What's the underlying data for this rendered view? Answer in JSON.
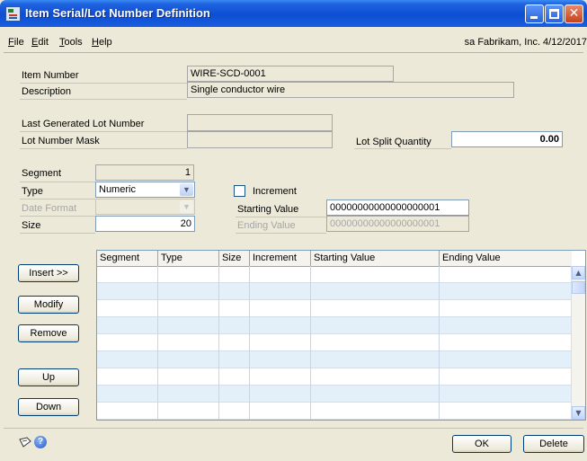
{
  "window": {
    "title": "Item Serial/Lot Number Definition"
  },
  "menu": {
    "items": [
      "File",
      "Edit",
      "Tools",
      "Help"
    ],
    "user_info": "sa  Fabrikam, Inc.  4/12/2017"
  },
  "header": {
    "item_number_label": "Item Number",
    "item_number_value": "WIRE-SCD-0001",
    "description_label": "Description",
    "description_value": "Single conductor wire",
    "last_generated_label": "Last Generated Lot Number",
    "last_generated_value": "",
    "lot_mask_label": "Lot Number Mask",
    "lot_mask_value": "",
    "lot_split_label": "Lot Split Quantity",
    "lot_split_value": "0.00"
  },
  "segment": {
    "segment_label": "Segment",
    "segment_value": "1",
    "type_label": "Type",
    "type_value": "Numeric",
    "date_format_label": "Date Format",
    "date_format_value": "",
    "size_label": "Size",
    "size_value": "20",
    "increment_label": "Increment",
    "increment_checked": false,
    "starting_value_label": "Starting Value",
    "starting_value": "00000000000000000001",
    "ending_value_label": "Ending Value",
    "ending_value": "00000000000000000001"
  },
  "buttons": {
    "insert": "Insert >>",
    "modify": "Modify",
    "remove": "Remove",
    "up": "Up",
    "down": "Down",
    "ok": "OK",
    "delete": "Delete"
  },
  "grid": {
    "columns": [
      "Segment",
      "Type",
      "Size",
      "Increment",
      "Starting Value",
      "Ending Value"
    ],
    "row_count": 9
  },
  "icons": {
    "note": "note-icon",
    "help": "help-icon"
  }
}
